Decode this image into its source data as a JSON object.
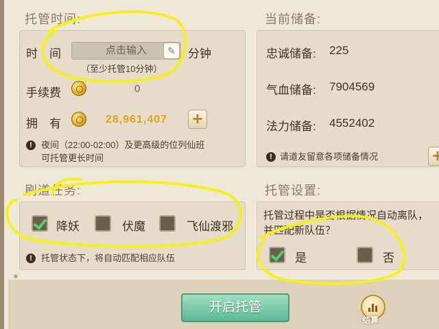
{
  "hosting_time": {
    "title": "托管时间:",
    "time_label": "时　间",
    "input_placeholder": "点击输入",
    "unit": "分钟",
    "hint": "（至少托管10分钟）",
    "fee_label": "手续费",
    "fee_value": "0",
    "own_label": "拥　有",
    "own_value": "28,961,407",
    "note_line1": "夜间（22:00-02:00）及更高级的位列仙班",
    "note_line2": "可托管更长时间"
  },
  "reserves": {
    "title": "当前储备:",
    "loyalty_label": "忠诚储备:",
    "loyalty_value": "225",
    "hp_label": "气血储备:",
    "hp_value": "7904569",
    "mp_label": "法力储备:",
    "mp_value": "4552402",
    "note": "请道友留意各项储备情况"
  },
  "tasks": {
    "title": "刷道任务:",
    "options": [
      {
        "label": "降妖",
        "checked": true
      },
      {
        "label": "伏魔",
        "checked": false
      },
      {
        "label": "飞仙渡邪",
        "checked": false
      }
    ],
    "note": "托管状态下，将自动匹配相应队伍"
  },
  "settings": {
    "title": "托管设置:",
    "question_line1": "托管过程中是否根据情况自动离队，",
    "question_line2": "并匹配新队伍？",
    "yes_label": "是",
    "yes_checked": true,
    "no_label": "否",
    "no_checked": false
  },
  "footer": {
    "start_button": "开启托管",
    "settle_label": "结算"
  },
  "colors": {
    "gold": "#e0a21a",
    "check_green": "#4fd36a",
    "annotation_yellow": "#f6f01a"
  }
}
